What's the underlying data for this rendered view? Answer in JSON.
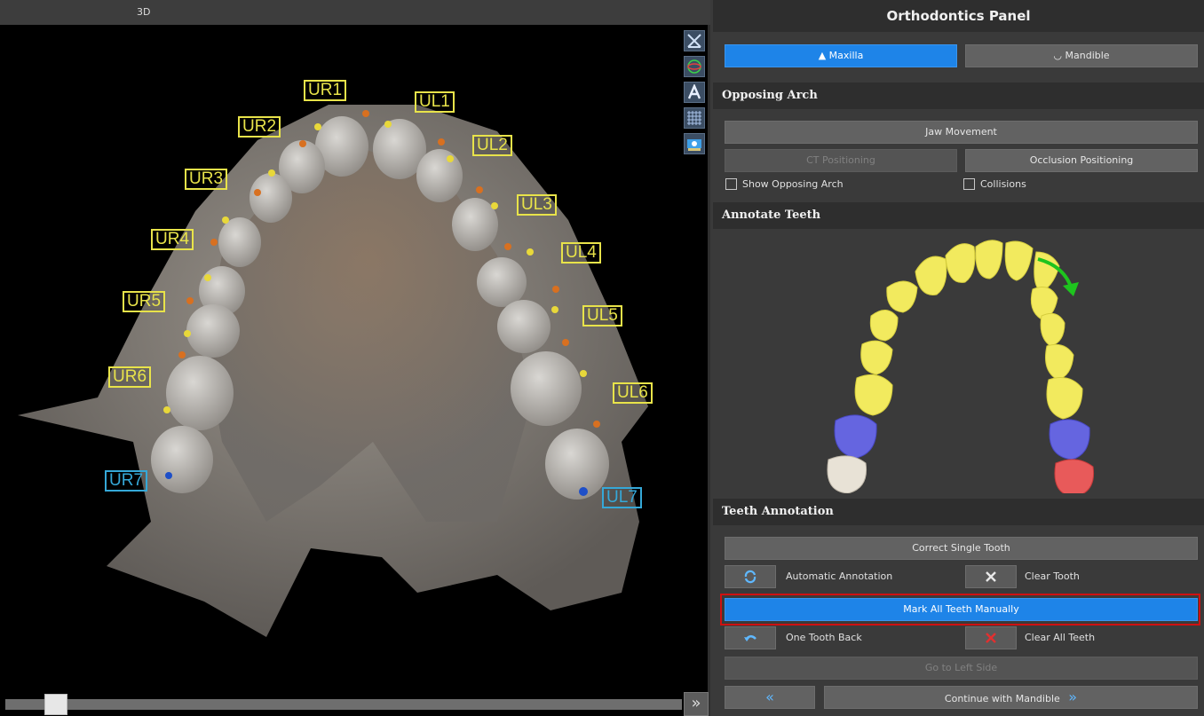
{
  "viewport": {
    "title": "3D",
    "labels": {
      "ur1": "UR1",
      "ul1": "UL1",
      "ur2": "UR2",
      "ul2": "UL2",
      "ur3": "UR3",
      "ul3": "UL3",
      "ur4": "UR4",
      "ul4": "UL4",
      "ur5": "UR5",
      "ul5": "UL5",
      "ur6": "UR6",
      "ul6": "UL6",
      "ur7": "UR7",
      "ul7": "UL7"
    },
    "toolbar_icons": [
      "measure-icon",
      "rotate-sphere-icon",
      "text-annotation-icon",
      "grid-icon",
      "screenshot-icon"
    ],
    "slider_value_percent": 6,
    "expand_glyph": "»"
  },
  "panel": {
    "title": "Orthodontics Panel",
    "arch_tabs": {
      "maxilla": "Maxilla",
      "mandible": "Mandible"
    },
    "opposing_arch": {
      "heading": "Opposing Arch",
      "jaw_movement": "Jaw Movement",
      "ct_positioning": "CT Positioning",
      "occlusion_positioning": "Occlusion Positioning",
      "show_opposing_arch": "Show Opposing Arch",
      "collisions": "Collisions"
    },
    "annotate_teeth": {
      "heading": "Annotate Teeth"
    },
    "teeth_annotation": {
      "heading": "Teeth Annotation",
      "correct_single_tooth": "Correct Single Tooth",
      "automatic_annotation": "Automatic Annotation",
      "clear_tooth": "Clear Tooth",
      "mark_all_manually": "Mark All Teeth Manually",
      "one_tooth_back": "One Tooth Back",
      "clear_all_teeth": "Clear All Teeth",
      "go_to_left_side": "Go to Left Side"
    },
    "nav": {
      "back_glyph": "«",
      "continue_mandible": "Continue with Mandible",
      "forward_glyph": "»"
    }
  },
  "colors": {
    "accent_blue": "#1e84e8",
    "label_yellow": "#e8e34a",
    "label_blue": "#35a8d8",
    "highlight_red": "#d01010",
    "tooth_yellow": "#f2ea5e",
    "tooth_purple": "#6565e0",
    "tooth_white": "#e8e2d6",
    "tooth_red": "#e85a5a",
    "arrow_green": "#1ec41e"
  }
}
